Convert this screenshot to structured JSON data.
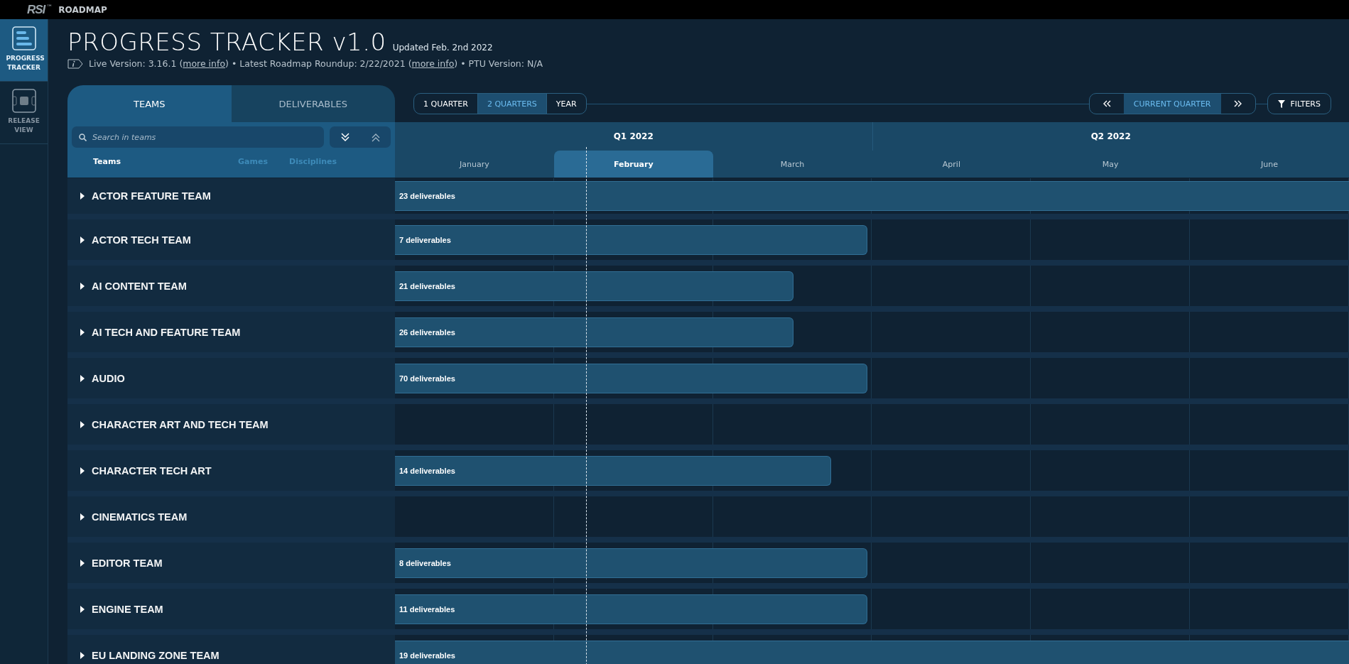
{
  "top_bar": {
    "logo": "RSI",
    "trademark": "™",
    "title": "ROADMAP"
  },
  "sidebar": {
    "items": [
      {
        "label": "PROGRESS TRACKER",
        "kind": "tracker",
        "selected": true
      },
      {
        "label": "RELEASE VIEW",
        "kind": "release",
        "selected": false
      }
    ]
  },
  "header": {
    "title": "PROGRESS TRACKER v1.0",
    "updated": "Updated Feb. 2nd 2022",
    "info": [
      {
        "kind": "text",
        "text": "Live Version: 3.16.1 ("
      },
      {
        "kind": "link",
        "text": "more info"
      },
      {
        "kind": "text",
        "text": ") • Latest Roadmap Roundup: 2/22/2021 ("
      },
      {
        "kind": "link",
        "text": "more info"
      },
      {
        "kind": "text",
        "text": ") • PTU Version: N/A"
      }
    ]
  },
  "panel_tabs": [
    {
      "label": "TEAMS",
      "selected": true
    },
    {
      "label": "DELIVERABLES",
      "selected": false
    }
  ],
  "search": {
    "placeholder": "Search in teams"
  },
  "filter_columns": [
    {
      "label": "Teams",
      "selected": true
    },
    {
      "label": "Games",
      "selected": false
    },
    {
      "label": "Disciplines",
      "selected": false
    }
  ],
  "view_buttons": [
    {
      "label": "1 QUARTER",
      "selected": false
    },
    {
      "label": "2 QUARTERS",
      "selected": true
    },
    {
      "label": "YEAR",
      "selected": false
    }
  ],
  "navigation": {
    "current": "CURRENT QUARTER"
  },
  "filters_button": "FILTERS",
  "quarters": [
    "Q1 2022",
    "Q2 2022"
  ],
  "months": [
    {
      "label": "January",
      "selected": false
    },
    {
      "label": "February",
      "selected": true
    },
    {
      "label": "March",
      "selected": false
    },
    {
      "label": "April",
      "selected": false
    },
    {
      "label": "May",
      "selected": false
    },
    {
      "label": "June",
      "selected": false
    }
  ],
  "teams": [
    {
      "name": "ACTOR FEATURE TEAM",
      "expanded": false,
      "deliverables": "23 deliverables",
      "level": 1
    },
    {
      "name": "ACTOR TECH TEAM",
      "expanded": false,
      "deliverables": "7 deliverables",
      "level": 0.495
    },
    {
      "name": "AI CONTENT TEAM",
      "expanded": false,
      "deliverables": "21 deliverables",
      "level": 0.418
    },
    {
      "name": "AI TECH AND FEATURE TEAM",
      "expanded": false,
      "deliverables": "26 deliverables",
      "level": 0.418
    },
    {
      "name": "AUDIO",
      "expanded": false,
      "deliverables": "70 deliverables",
      "level": 0.495
    },
    {
      "name": "CHARACTER ART AND TECH TEAM",
      "expanded": false
    },
    {
      "name": "CHARACTER TECH ART",
      "expanded": false,
      "deliverables": "14 deliverables",
      "level": 0.457
    },
    {
      "name": "CINEMATICS TEAM",
      "expanded": false
    },
    {
      "name": "EDITOR TEAM",
      "expanded": false,
      "deliverables": "8 deliverables",
      "level": 0.495
    },
    {
      "name": "ENGINE TEAM",
      "expanded": false,
      "deliverables": "11 deliverables",
      "level": 0.495
    },
    {
      "name": "EU LANDING ZONE TEAM",
      "expanded": false,
      "deliverables": "19 deliverables",
      "level": 1
    }
  ]
}
